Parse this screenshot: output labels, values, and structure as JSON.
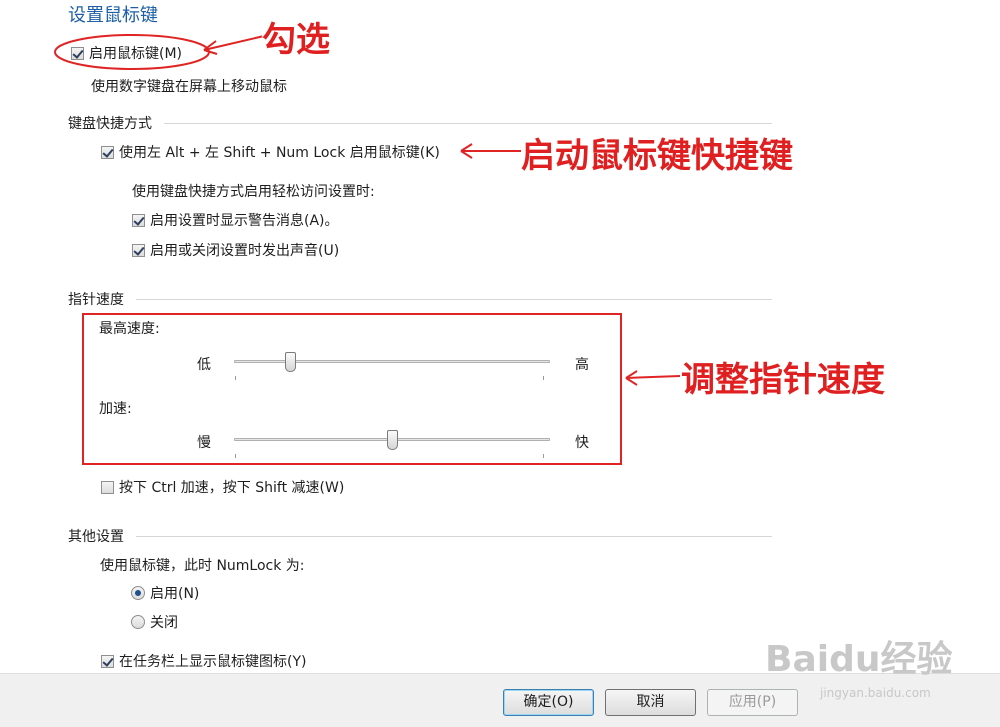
{
  "title": "设置鼠标键",
  "enable_mouse_keys": {
    "label": "启用鼠标键(M)",
    "checked": true,
    "description": "使用数字键盘在屏幕上移动鼠标"
  },
  "keyboard_shortcut": {
    "heading": "键盘快捷方式",
    "alt_shift_numlock": {
      "label": "使用左 Alt + 左 Shift + Num Lock 启用鼠标键(K)",
      "checked": true
    },
    "sub_heading": "使用键盘快捷方式启用轻松访问设置时:",
    "show_warning": {
      "label": "启用设置时显示警告消息(A)。",
      "checked": true
    },
    "make_sound": {
      "label": "启用或关闭设置时发出声音(U)",
      "checked": true
    }
  },
  "pointer_speed": {
    "heading": "指针速度",
    "top_speed": {
      "label": "最高速度:",
      "min_label": "低",
      "max_label": "高",
      "value": 0.18
    },
    "acceleration": {
      "label": "加速:",
      "min_label": "慢",
      "max_label": "快",
      "value": 0.5
    },
    "ctrl_shift": {
      "label": "按下 Ctrl 加速，按下 Shift 减速(W)",
      "checked": false
    }
  },
  "other_settings": {
    "heading": "其他设置",
    "numlock_label": "使用鼠标键，此时 NumLock 为:",
    "radio_on": {
      "label": "启用(N)",
      "selected": true
    },
    "radio_off": {
      "label": "关闭",
      "selected": false
    },
    "taskbar_icon": {
      "label": "在任务栏上显示鼠标键图标(Y)",
      "checked": true
    }
  },
  "buttons": {
    "ok": "确定(O)",
    "cancel": "取消",
    "apply": "应用(P)"
  },
  "annotations": {
    "check": "勾选",
    "shortcut": "启动鼠标键快捷键",
    "speed": "调整指针速度",
    "color": "#e02020"
  },
  "watermark": {
    "logo": "Baidu经验",
    "url": "jingyan.baidu.com"
  }
}
